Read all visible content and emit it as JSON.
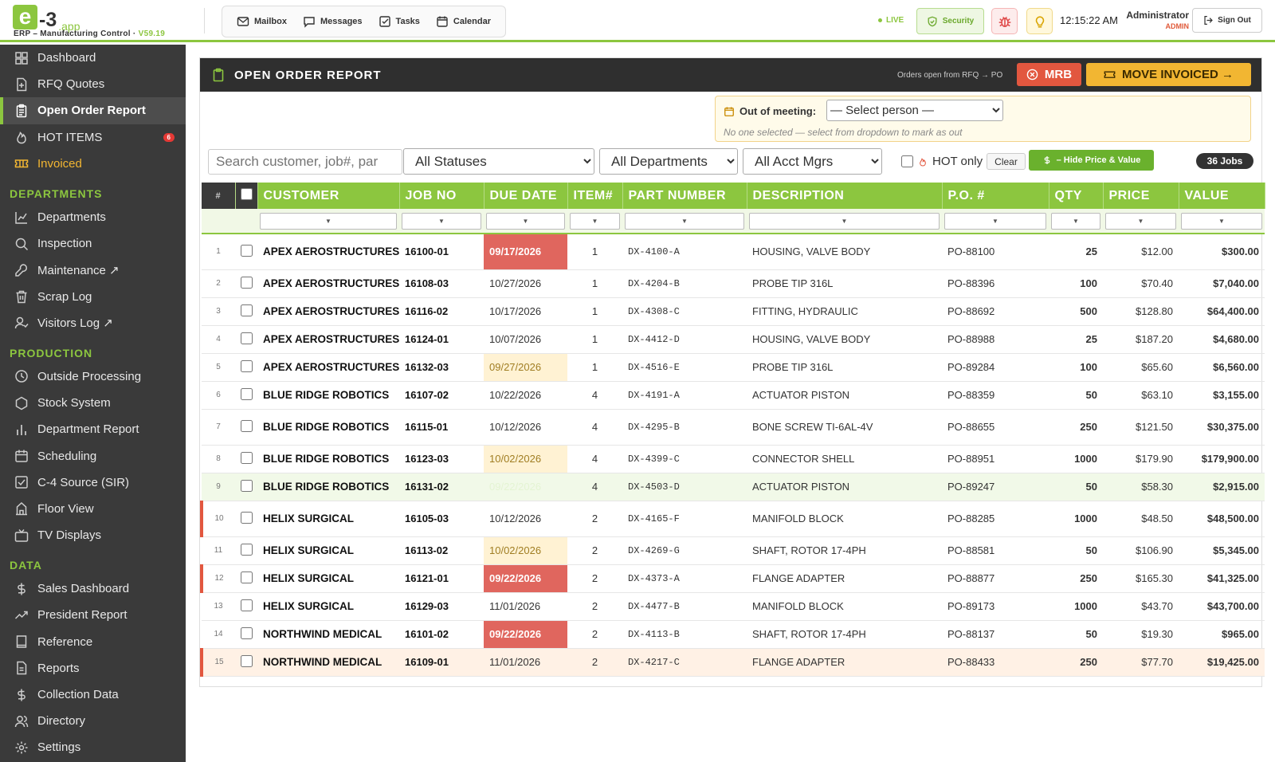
{
  "app": {
    "logo_e": "e",
    "logo_num": "-3",
    "logo_app": ".app",
    "subtitle": "ERP – Manufacturing Control · ",
    "version": "V59.19"
  },
  "header": {
    "nav": [
      {
        "label": "Mailbox",
        "icon": "mailbox-icon"
      },
      {
        "label": "Messages",
        "icon": "messages-icon"
      },
      {
        "label": "Tasks",
        "icon": "tasks-icon"
      },
      {
        "label": "Calendar",
        "icon": "calendar-icon"
      }
    ],
    "live": "LIVE",
    "security": "Security",
    "clock": "12:15:22 AM",
    "user_name": "Administrator",
    "user_role": "ADMIN",
    "signout": "Sign Out"
  },
  "sidebar": {
    "top": [
      {
        "label": "Dashboard",
        "icon": "dashboard-icon"
      },
      {
        "label": "RFQ Quotes",
        "icon": "rfq-icon"
      },
      {
        "label": "Open Order Report",
        "icon": "clipboard-icon",
        "active": true
      },
      {
        "label": "HOT ITEMS",
        "icon": "flame-icon",
        "badge": "6"
      },
      {
        "label": "Invoiced",
        "icon": "ticket-icon",
        "gold": true
      }
    ],
    "sections": [
      {
        "title": "DEPARTMENTS",
        "items": [
          {
            "label": "Departments",
            "icon": "chart-icon"
          },
          {
            "label": "Inspection",
            "icon": "inspection-icon"
          },
          {
            "label": "Maintenance ↗",
            "icon": "wrench-icon"
          },
          {
            "label": "Scrap Log",
            "icon": "trash-icon"
          },
          {
            "label": "Visitors Log ↗",
            "icon": "visitor-icon"
          }
        ]
      },
      {
        "title": "PRODUCTION",
        "items": [
          {
            "label": "Outside Processing",
            "icon": "clock-icon"
          },
          {
            "label": "Stock System",
            "icon": "hexagon-icon"
          },
          {
            "label": "Department Report",
            "icon": "bars-icon"
          },
          {
            "label": "Scheduling",
            "icon": "calendar-icon"
          },
          {
            "label": "C-4 Source (SIR)",
            "icon": "checkbox-icon"
          },
          {
            "label": "Floor View",
            "icon": "building-icon"
          },
          {
            "label": "TV Displays",
            "icon": "tv-icon"
          }
        ]
      },
      {
        "title": "DATA",
        "items": [
          {
            "label": "Sales Dashboard",
            "icon": "dollar-icon"
          },
          {
            "label": "President Report",
            "icon": "trend-icon"
          },
          {
            "label": "Reference",
            "icon": "book-icon"
          },
          {
            "label": "Reports",
            "icon": "report-icon"
          },
          {
            "label": "Collection Data",
            "icon": "dollar-icon"
          },
          {
            "label": "Directory",
            "icon": "people-icon"
          },
          {
            "label": "Settings",
            "icon": "gear-icon"
          }
        ]
      }
    ]
  },
  "report": {
    "title": "OPEN ORDER REPORT",
    "orders_text": "Orders open from RFQ → PO",
    "mrb": "MRB",
    "move_invoiced": "MOVE INVOICED →",
    "meeting_label": "Out of meeting:",
    "meeting_select": "— Select person —",
    "meeting_note": "No one selected — select from dropdown to mark as out",
    "search_placeholder": "Search customer, job#, par",
    "status_filter": "All Statuses",
    "dept_filter": "All Departments",
    "acct_filter": "All Acct Mgrs",
    "hot_only": "HOT only",
    "clear": "Clear",
    "hide_price": "– Hide Price & Value",
    "jobs_count": "36 Jobs",
    "columns": {
      "num": "#",
      "customer": "CUSTOMER",
      "job": "JOB NO",
      "due": "DUE DATE",
      "item": "ITEM#",
      "part": "PART NUMBER",
      "desc": "DESCRIPTION",
      "po": "P.O. #",
      "qty": "QTY",
      "price": "PRICE",
      "value": "VALUE"
    },
    "filter_arrow": "▼",
    "rows": [
      {
        "n": "1",
        "customer": "APEX AEROSTRUCTURES",
        "job": "16100-01",
        "due": "09/17/2026",
        "due_state": "red",
        "item": "1",
        "part": "DX-4100-A",
        "desc": "HOUSING, VALVE BODY",
        "po": "PO-88100",
        "qty": "25",
        "price": "$12.00",
        "value": "$300.00",
        "row_state": "",
        "h": 45
      },
      {
        "n": "2",
        "customer": "APEX AEROSTRUCTURES",
        "job": "16108-03",
        "due": "10/27/2026",
        "due_state": "",
        "item": "1",
        "part": "DX-4204-B",
        "desc": "PROBE TIP 316L",
        "po": "PO-88396",
        "qty": "100",
        "price": "$70.40",
        "value": "$7,040.00",
        "row_state": "",
        "h": 35
      },
      {
        "n": "3",
        "customer": "APEX AEROSTRUCTURES",
        "job": "16116-02",
        "due": "10/17/2026",
        "due_state": "",
        "item": "1",
        "part": "DX-4308-C",
        "desc": "FITTING, HYDRAULIC",
        "po": "PO-88692",
        "qty": "500",
        "price": "$128.80",
        "value": "$64,400.00",
        "row_state": "",
        "h": 35
      },
      {
        "n": "4",
        "customer": "APEX AEROSTRUCTURES",
        "job": "16124-01",
        "due": "10/07/2026",
        "due_state": "",
        "item": "1",
        "part": "DX-4412-D",
        "desc": "HOUSING, VALVE BODY",
        "po": "PO-88988",
        "qty": "25",
        "price": "$187.20",
        "value": "$4,680.00",
        "row_state": "",
        "h": 35
      },
      {
        "n": "5",
        "customer": "APEX AEROSTRUCTURES",
        "job": "16132-03",
        "due": "09/27/2026",
        "due_state": "yel",
        "item": "1",
        "part": "DX-4516-E",
        "desc": "PROBE TIP 316L",
        "po": "PO-89284",
        "qty": "100",
        "price": "$65.60",
        "value": "$6,560.00",
        "row_state": "",
        "h": 35
      },
      {
        "n": "6",
        "customer": "BLUE RIDGE ROBOTICS",
        "job": "16107-02",
        "due": "10/22/2026",
        "due_state": "",
        "item": "4",
        "part": "DX-4191-A",
        "desc": "ACTUATOR PISTON",
        "po": "PO-88359",
        "qty": "50",
        "price": "$63.10",
        "value": "$3,155.00",
        "row_state": "",
        "h": 35
      },
      {
        "n": "7",
        "customer": "BLUE RIDGE ROBOTICS",
        "job": "16115-01",
        "due": "10/12/2026",
        "due_state": "",
        "item": "4",
        "part": "DX-4295-B",
        "desc": "BONE SCREW TI-6AL-4V",
        "po": "PO-88655",
        "qty": "250",
        "price": "$121.50",
        "value": "$30,375.00",
        "row_state": "",
        "h": 45
      },
      {
        "n": "8",
        "customer": "BLUE RIDGE ROBOTICS",
        "job": "16123-03",
        "due": "10/02/2026",
        "due_state": "yel",
        "item": "4",
        "part": "DX-4399-C",
        "desc": "CONNECTOR SHELL",
        "po": "PO-88951",
        "qty": "1000",
        "price": "$179.90",
        "value": "$179,900.00",
        "row_state": "",
        "h": 35
      },
      {
        "n": "9",
        "customer": "BLUE RIDGE ROBOTICS",
        "job": "16131-02",
        "due": "09/22/2026",
        "due_state": "grn",
        "item": "4",
        "part": "DX-4503-D",
        "desc": "ACTUATOR PISTON",
        "po": "PO-89247",
        "qty": "50",
        "price": "$58.30",
        "value": "$2,915.00",
        "row_state": "grn",
        "h": 35
      },
      {
        "n": "10",
        "customer": "HELIX SURGICAL",
        "job": "16105-03",
        "due": "10/12/2026",
        "due_state": "",
        "item": "2",
        "part": "DX-4165-F",
        "desc": "MANIFOLD BLOCK",
        "po": "PO-88285",
        "qty": "1000",
        "price": "$48.50",
        "value": "$48,500.00",
        "row_state": "redbar",
        "h": 45
      },
      {
        "n": "11",
        "customer": "HELIX SURGICAL",
        "job": "16113-02",
        "due": "10/02/2026",
        "due_state": "yel",
        "item": "2",
        "part": "DX-4269-G",
        "desc": "SHAFT, ROTOR 17-4PH",
        "po": "PO-88581",
        "qty": "50",
        "price": "$106.90",
        "value": "$5,345.00",
        "row_state": "",
        "h": 35
      },
      {
        "n": "12",
        "customer": "HELIX SURGICAL",
        "job": "16121-01",
        "due": "09/22/2026",
        "due_state": "red",
        "item": "2",
        "part": "DX-4373-A",
        "desc": "FLANGE ADAPTER",
        "po": "PO-88877",
        "qty": "250",
        "price": "$165.30",
        "value": "$41,325.00",
        "row_state": "redbar",
        "h": 35
      },
      {
        "n": "13",
        "customer": "HELIX SURGICAL",
        "job": "16129-03",
        "due": "11/01/2026",
        "due_state": "",
        "item": "2",
        "part": "DX-4477-B",
        "desc": "MANIFOLD BLOCK",
        "po": "PO-89173",
        "qty": "1000",
        "price": "$43.70",
        "value": "$43,700.00",
        "row_state": "",
        "h": 35
      },
      {
        "n": "14",
        "customer": "NORTHWIND MEDICAL",
        "job": "16101-02",
        "due": "09/22/2026",
        "due_state": "red",
        "item": "2",
        "part": "DX-4113-B",
        "desc": "SHAFT, ROTOR 17-4PH",
        "po": "PO-88137",
        "qty": "50",
        "price": "$19.30",
        "value": "$965.00",
        "row_state": "",
        "h": 35
      },
      {
        "n": "15",
        "customer": "NORTHWIND MEDICAL",
        "job": "16109-01",
        "due": "11/01/2026",
        "due_state": "",
        "item": "2",
        "part": "DX-4217-C",
        "desc": "FLANGE ADAPTER",
        "po": "PO-88433",
        "qty": "250",
        "price": "$77.70",
        "value": "$19,425.00",
        "row_state": "org redbar",
        "h": 35
      }
    ]
  },
  "colors": {
    "accent": "#8cc63f",
    "dark": "#3a3a3a",
    "red": "#e0665e",
    "gold": "#f2b632"
  }
}
